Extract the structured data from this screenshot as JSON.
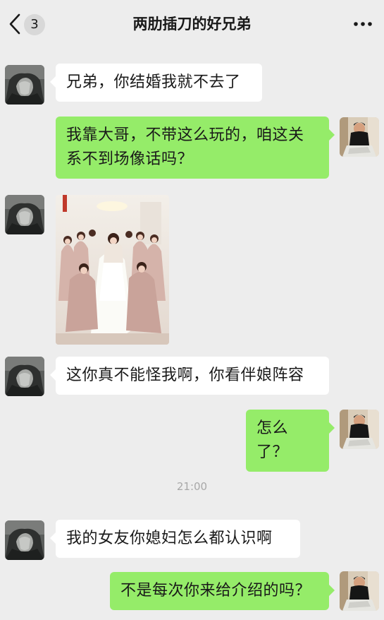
{
  "header": {
    "unread_count": "3",
    "title": "两肋插刀的好兄弟",
    "back_icon": "chevron-left-icon",
    "more_icon": "more-dots-icon"
  },
  "messages": [
    {
      "from": "friend",
      "text": "兄弟，你结婚我就不去了"
    },
    {
      "from": "me",
      "text": "我靠大哥，不带这么玩的，咱这关系不到场像话吗？"
    },
    {
      "from": "friend",
      "type": "image"
    },
    {
      "from": "friend",
      "text": "这你真不能怪我啊，你看伴娘阵容"
    },
    {
      "from": "me",
      "text": "怎么了？"
    },
    {
      "from": "friend",
      "text": "我的女友你媳妇怎么都认识啊"
    },
    {
      "from": "me",
      "text": "不是每次你来给介绍的吗？"
    }
  ],
  "timestamp": "21:00",
  "colors": {
    "background": "#ededed",
    "outgoing_bubble": "#95ec69",
    "incoming_bubble": "#ffffff"
  }
}
